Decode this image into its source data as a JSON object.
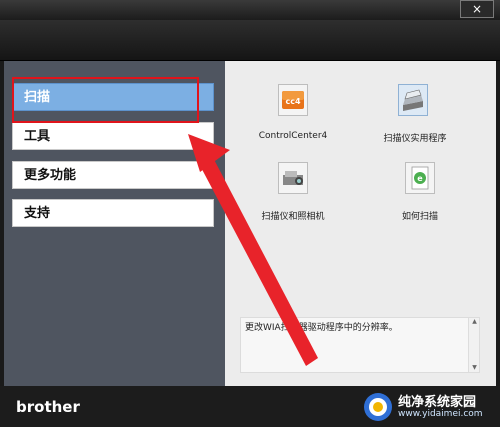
{
  "window": {
    "close_glyph": "×"
  },
  "sidebar": {
    "items": [
      {
        "label": "扫描",
        "active": true
      },
      {
        "label": "工具",
        "active": false
      },
      {
        "label": "更多功能",
        "active": false
      },
      {
        "label": "支持",
        "active": false
      }
    ]
  },
  "content": {
    "tiles": [
      {
        "label": "ControlCenter4",
        "icon": "controlcenter4-icon"
      },
      {
        "label": "扫描仪实用程序",
        "icon": "scanner-icon"
      },
      {
        "label": "扫描仪和照相机",
        "icon": "camera-scanner-icon"
      },
      {
        "label": "如何扫描",
        "icon": "help-document-icon"
      }
    ],
    "description": "更改WIA扫描器驱动程序中的分辨率。"
  },
  "footer": {
    "brand": "brother"
  },
  "watermark": {
    "title": "纯净系统家园",
    "url": "www.yidaimei.com"
  },
  "colors": {
    "active_nav": "#7cafe3",
    "annotation": "#e0141b",
    "sidebar": "#4f5560"
  }
}
